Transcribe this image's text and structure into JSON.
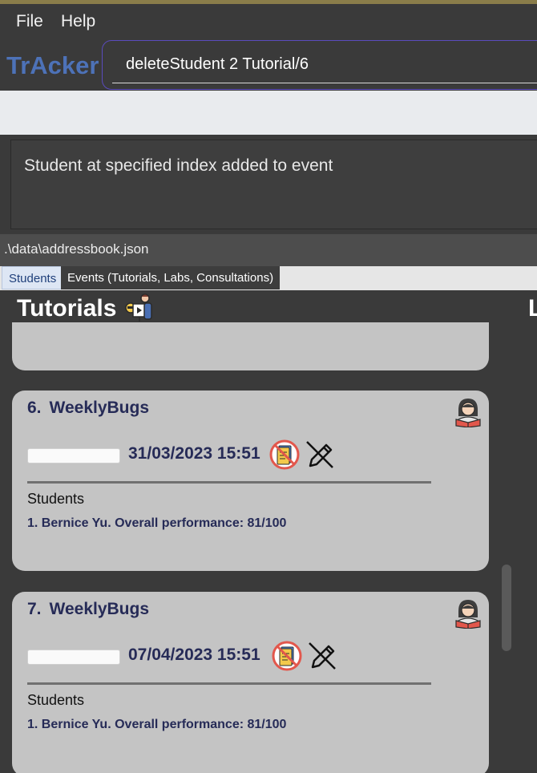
{
  "menu": {
    "file": "File",
    "help": "Help"
  },
  "app": {
    "name": "TrAcker"
  },
  "command": {
    "value": "deleteStudent 2 Tutorial/6"
  },
  "result": {
    "message": "Student at specified index added to event"
  },
  "status": {
    "path": ".\\data\\addressbook.json"
  },
  "tabs": [
    {
      "label": "Students"
    },
    {
      "label": "Events (Tutorials, Labs, Consultations)"
    }
  ],
  "section": {
    "title": "Tutorials",
    "next_title_partial": "L"
  },
  "cards": [
    {
      "index": "6.",
      "name": "WeeklyBugs",
      "datetime": "31/03/2023 15:51",
      "students_label": "Students",
      "students": [
        "1. Bernice Yu. Overall performance: 81/100"
      ],
      "progress": 0
    },
    {
      "index": "7.",
      "name": "WeeklyBugs",
      "datetime": "07/04/2023 15:51",
      "students_label": "Students",
      "students": [
        "1. Bernice Yu. Overall performance: 81/100"
      ],
      "progress": 0
    }
  ],
  "icons": {
    "heading": "teacher-presentation-icon",
    "avatar": "student-reading-icon",
    "note": "no-notes-icon",
    "pen": "no-edit-pen-icon"
  }
}
